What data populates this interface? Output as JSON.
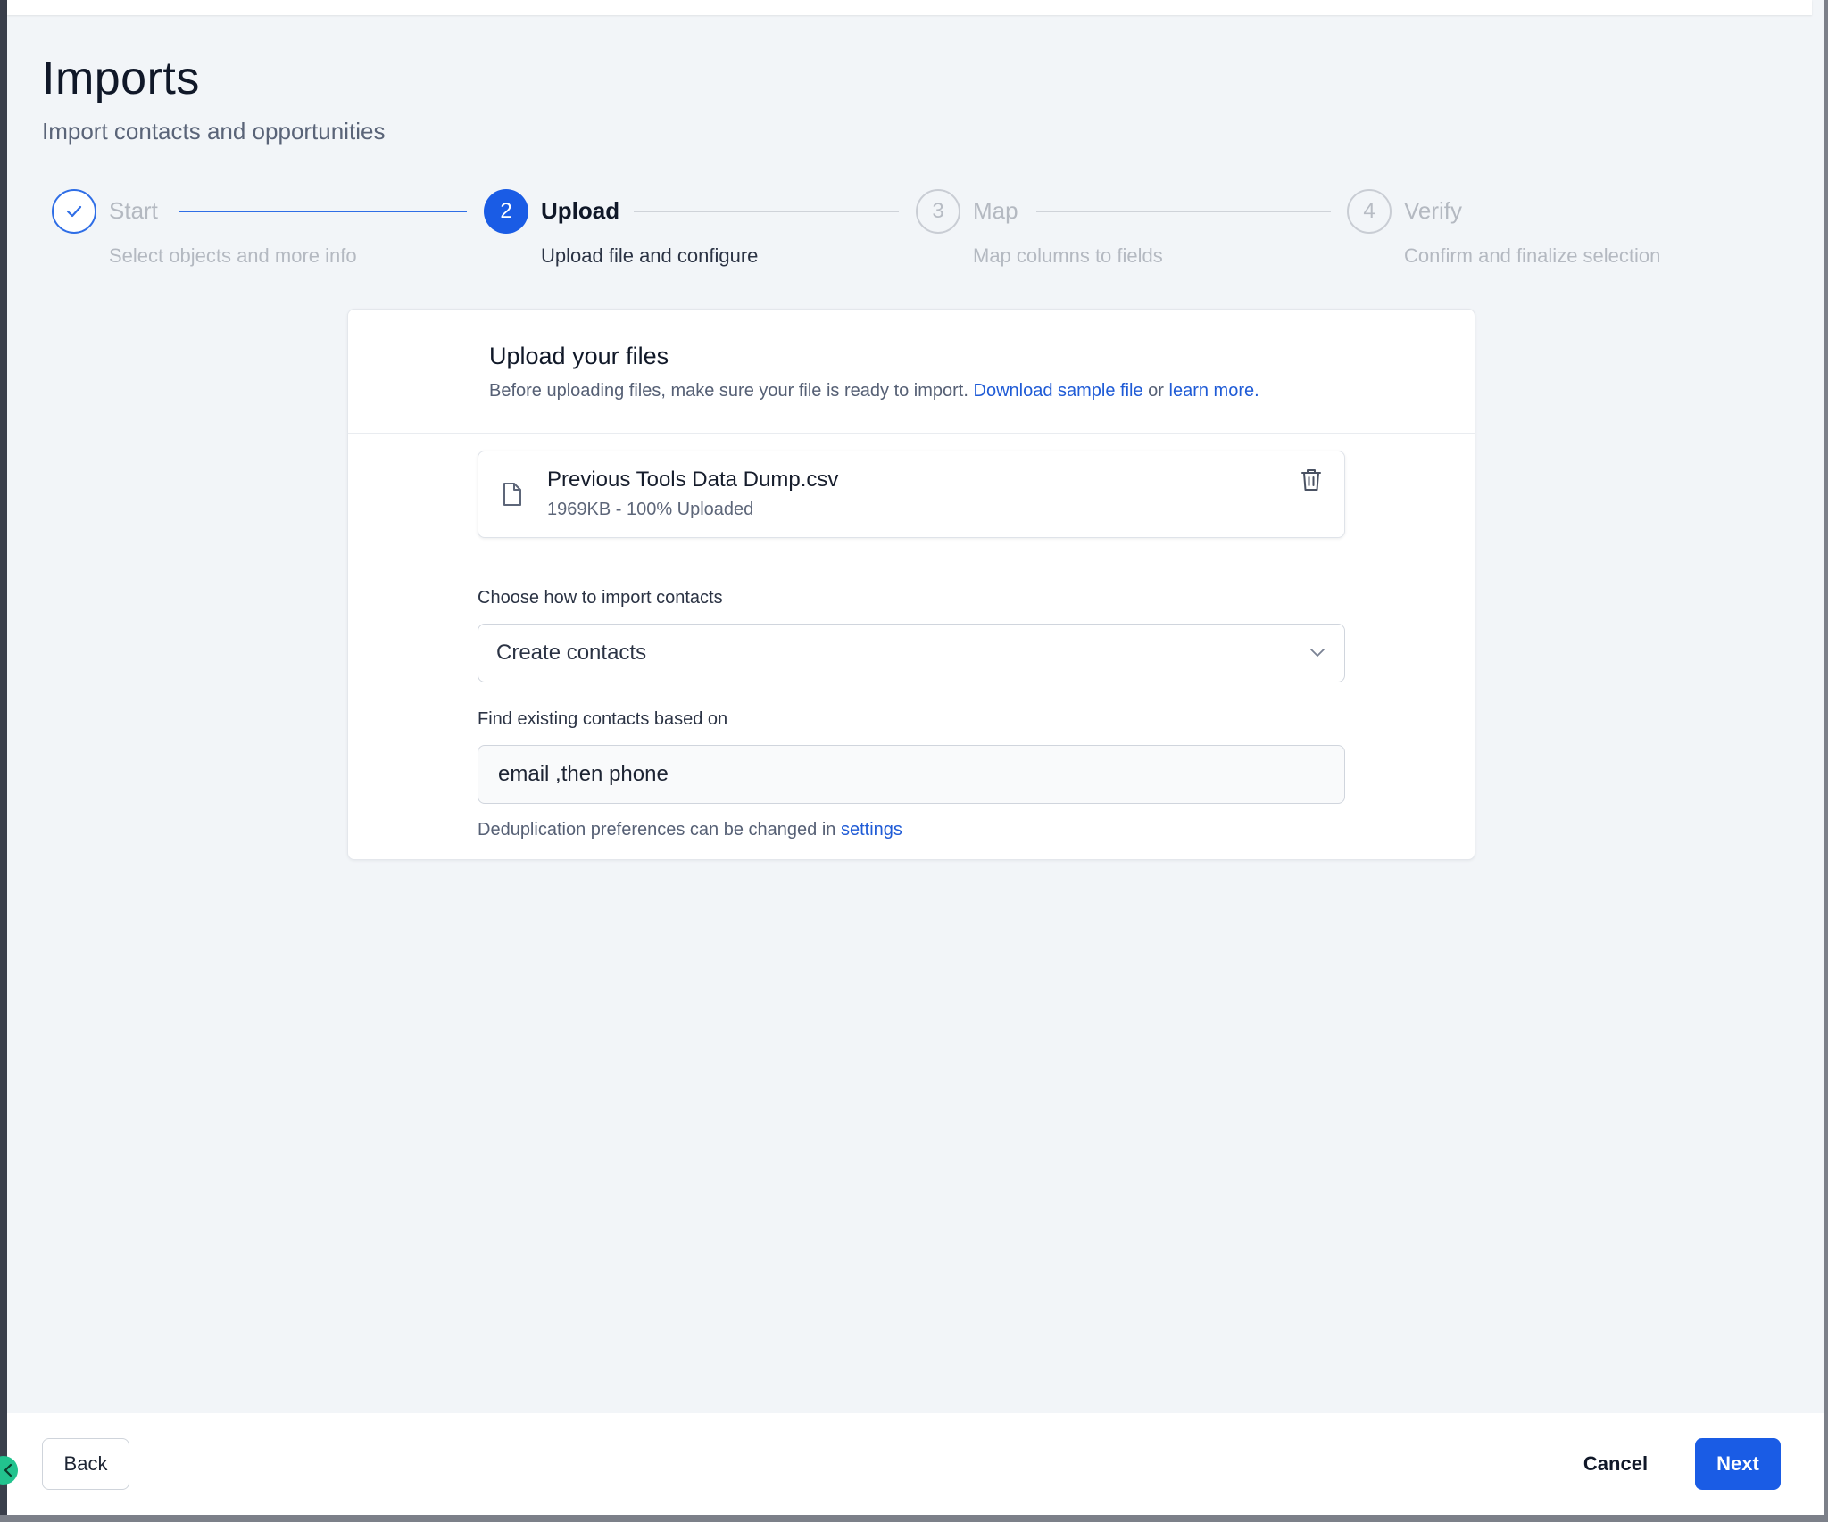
{
  "header": {
    "title": "Imports",
    "subtitle": "Import contacts and opportunities"
  },
  "stepper": {
    "steps": [
      {
        "number": "",
        "title": "Start",
        "description": "Select objects and more info",
        "state": "complete"
      },
      {
        "number": "2",
        "title": "Upload",
        "description": "Upload file and configure",
        "state": "active"
      },
      {
        "number": "3",
        "title": "Map",
        "description": "Map columns to fields",
        "state": "pending"
      },
      {
        "number": "4",
        "title": "Verify",
        "description": "Confirm and finalize selection",
        "state": "pending"
      }
    ]
  },
  "upload": {
    "title": "Upload your files",
    "note_prefix": "Before uploading files, make sure your file is ready to import.",
    "download_link": "Download sample file",
    "note_or": "or",
    "learn_link": "learn more.",
    "file": {
      "name": "Previous Tools Data Dump.csv",
      "meta": "1969KB - 100% Uploaded"
    }
  },
  "form": {
    "import_label": "Choose how to import contacts",
    "import_value": "Create contacts",
    "find_label": "Find existing contacts based on",
    "find_value": "email ,then phone",
    "helper_prefix": "Deduplication preferences can be changed in",
    "helper_link": "settings"
  },
  "footer": {
    "back": "Back",
    "cancel": "Cancel",
    "next": "Next"
  },
  "icons": {
    "step_complete": "check-icon",
    "file": "file-icon",
    "delete": "trash-icon",
    "dropdown": "chevron-down-icon",
    "collapse": "chevron-left-icon"
  },
  "colors": {
    "accent": "#1a5ce5",
    "link": "#1f5bd6",
    "collapse_handle": "#22c38e"
  }
}
